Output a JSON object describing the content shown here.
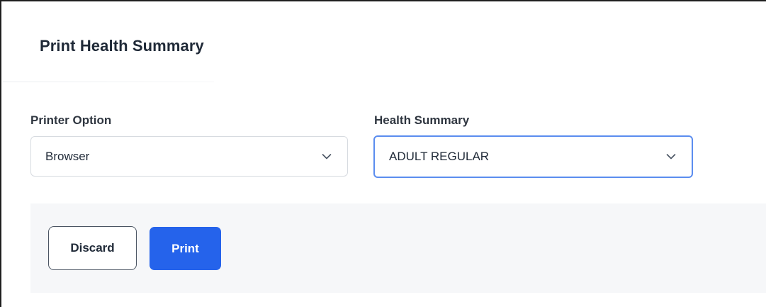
{
  "dialog": {
    "title": "Print Health Summary"
  },
  "printer_option": {
    "label": "Printer Option",
    "value": "Browser"
  },
  "health_summary": {
    "label": "Health Summary",
    "value": "ADULT REGULAR"
  },
  "actions": {
    "discard_label": "Discard",
    "print_label": "Print"
  },
  "colors": {
    "primary": "#2563eb",
    "focus_border": "#5b8def",
    "footer_bg": "#f6f7f9"
  },
  "icons": {
    "select_indicator": "chevron-down-icon"
  }
}
